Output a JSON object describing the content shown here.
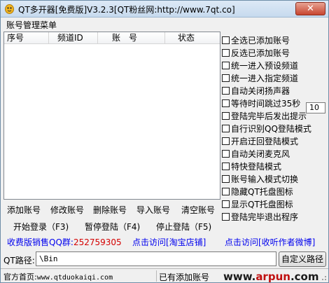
{
  "window": {
    "title": "QT多开器[免费版]V3.2.3[QT粉丝网:http://www.7qt.co]",
    "close_label": "✕"
  },
  "menu": {
    "label": "账号管理菜单"
  },
  "table": {
    "columns": [
      "序号",
      "频道ID",
      "账　号",
      "状态"
    ],
    "rows": []
  },
  "options": [
    {
      "label": "全选已添加账号",
      "checked": false
    },
    {
      "label": "反选已添加账号",
      "checked": false
    },
    {
      "label": "统一进入预设频道",
      "checked": false
    },
    {
      "label": "统一进入指定频道",
      "checked": false
    },
    {
      "label": "自动关闭扬声器",
      "checked": false
    },
    {
      "label": "等待时间跳过35秒",
      "checked": false
    },
    {
      "label": "登陆完毕后发出提示",
      "checked": false
    },
    {
      "label": "自行识别QQ登陆模式",
      "checked": false
    },
    {
      "label": "开启迂回登陆模式",
      "checked": false
    },
    {
      "label": "自动关闭麦克风",
      "checked": false
    },
    {
      "label": "特快登陆模式",
      "checked": false
    },
    {
      "label": "账号输入模式切换",
      "checked": false
    },
    {
      "label": "隐藏QT托盘图标",
      "checked": false
    },
    {
      "label": "显示QT托盘图标",
      "checked": false
    },
    {
      "label": "登陆完毕退出程序",
      "checked": false
    }
  ],
  "channel_number": "10",
  "account_buttons": [
    "添加账号",
    "修改账号",
    "删除账号",
    "导入账号",
    "清空账号"
  ],
  "login_buttons": [
    "开始登录（F3)",
    "暂停登陆（F4)",
    "停止登陆（F5)"
  ],
  "links": {
    "sales_qq_label": "收费版销售QQ群:",
    "sales_qq_number": "252759305",
    "taobao": "点击访问[淘宝店铺]",
    "weibo": "点击访问[收听作者微博]"
  },
  "path": {
    "label": "QT路径:",
    "value": "\\Bin",
    "button": "自定义路径"
  },
  "status": {
    "homepage_label": "官方首页:",
    "homepage_url": "www.qtduokaiqi.com",
    "added_accounts": "已有添加账号",
    "watermark_a": "www.",
    "watermark_b": "arpun",
    "watermark_c": ".com"
  },
  "colors": {
    "link": "#0000ee",
    "accent_red": "#d40000"
  }
}
